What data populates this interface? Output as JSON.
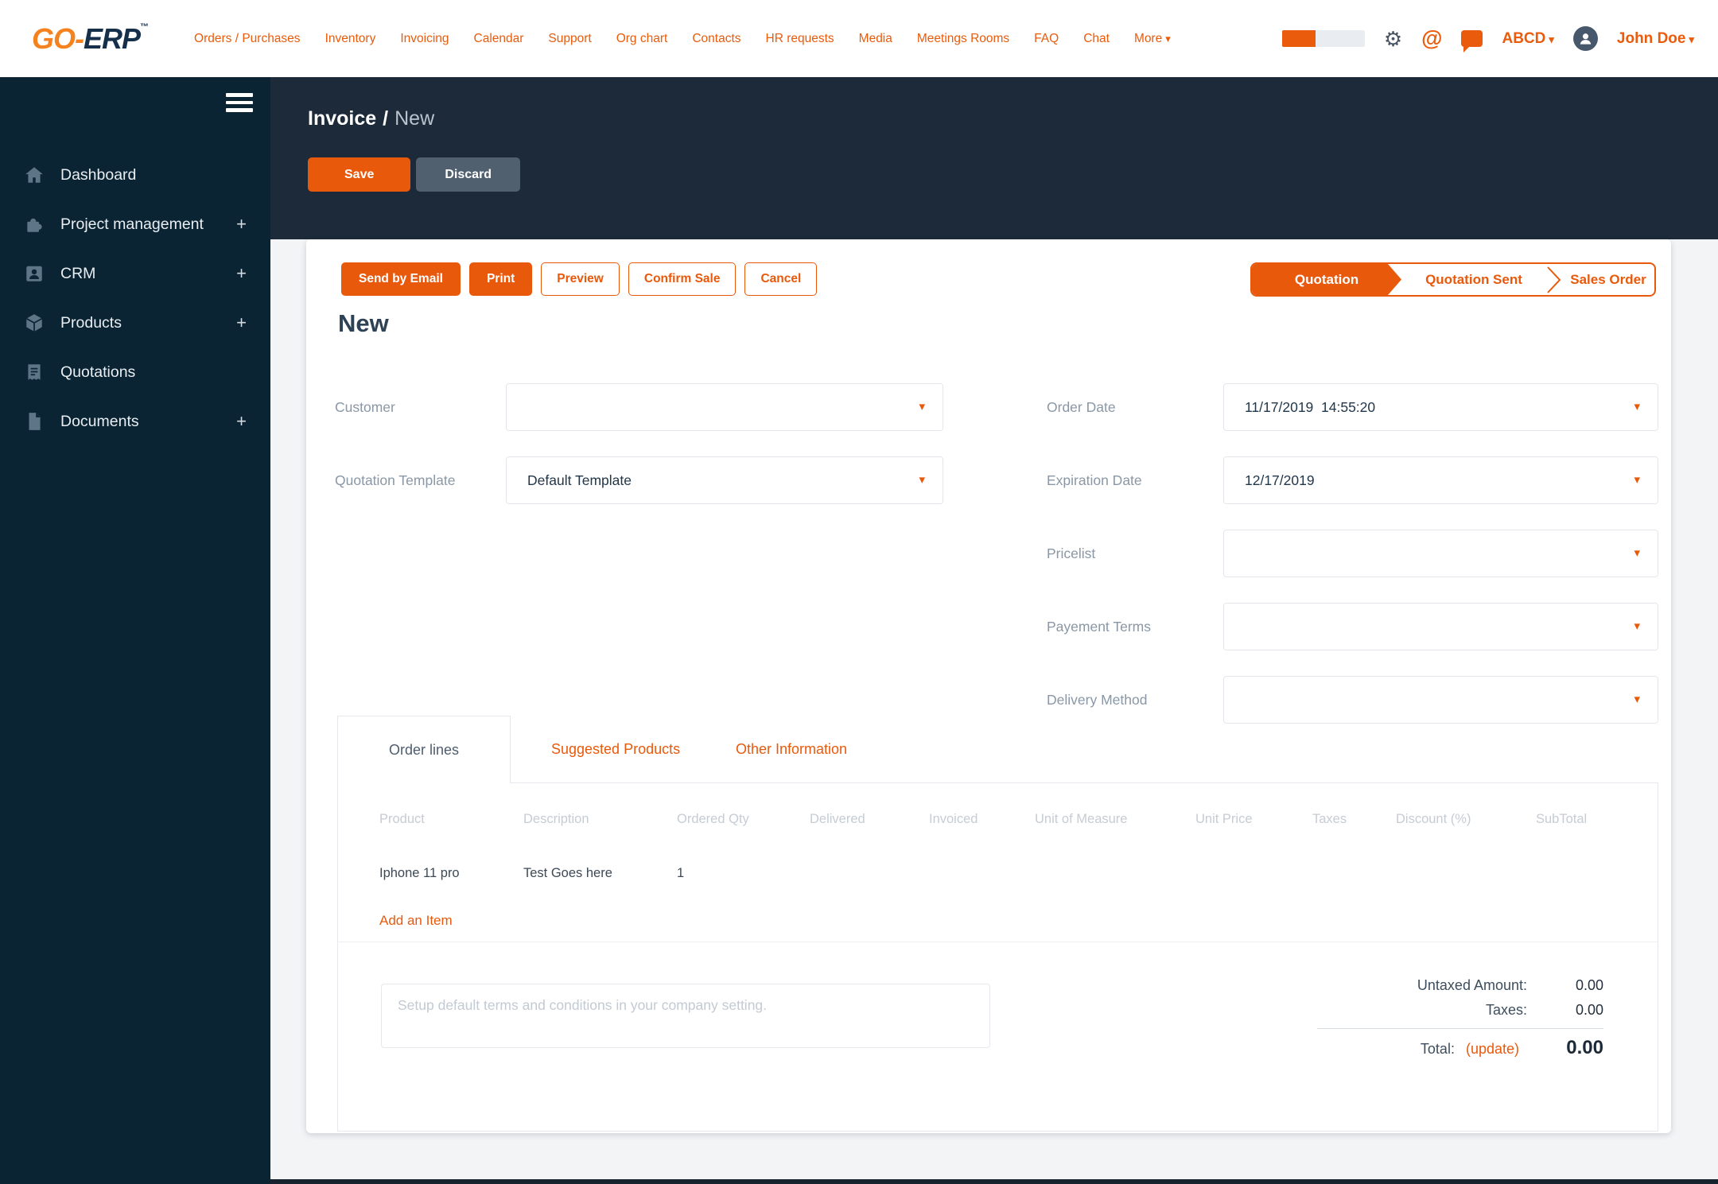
{
  "topnav": {
    "logo_part1": "GO-",
    "logo_part2": "ERP",
    "logo_tm": "™",
    "items": [
      "Orders / Purchases",
      "Inventory",
      "Invoicing",
      "Calendar",
      "Support",
      "Org chart",
      "Contacts",
      "HR requests",
      "Media",
      "Meetings Rooms",
      "FAQ",
      "Chat"
    ],
    "more_label": "More",
    "company": "ABCD",
    "user": "John Doe"
  },
  "sidebar": {
    "items": [
      {
        "label": "Dashboard",
        "plus": ""
      },
      {
        "label": "Project management",
        "plus": "+"
      },
      {
        "label": "CRM",
        "plus": "+"
      },
      {
        "label": "Products",
        "plus": "+"
      },
      {
        "label": "Quotations",
        "plus": ""
      },
      {
        "label": "Documents",
        "plus": "+"
      }
    ]
  },
  "header": {
    "breadcrumb_root": "Invoice",
    "breadcrumb_sep": "/",
    "breadcrumb_current": "New",
    "save_label": "Save",
    "discard_label": "Discard"
  },
  "actions": {
    "send_email": "Send by Email",
    "print": "Print",
    "preview": "Preview",
    "confirm_sale": "Confirm Sale",
    "cancel": "Cancel"
  },
  "pipeline": {
    "stage1": "Quotation",
    "stage2": "Quotation Sent",
    "stage3": "Sales Order"
  },
  "form": {
    "title": "New",
    "customer_label": "Customer",
    "customer_value": "",
    "quotation_template_label": "Quotation Template",
    "quotation_template_value": "Default Template",
    "order_date_label": "Order Date",
    "order_date_value": "11/17/2019  14:55:20",
    "expiration_date_label": "Expiration Date",
    "expiration_date_value": "12/17/2019",
    "pricelist_label": "Pricelist",
    "pricelist_value": "",
    "payment_terms_label": "Payement Terms",
    "payment_terms_value": "",
    "delivery_method_label": "Delivery Method",
    "delivery_method_value": ""
  },
  "tabs": {
    "order_lines": "Order lines",
    "suggested_products": "Suggested Products",
    "other_information": "Other Information"
  },
  "order_table": {
    "columns": [
      "Product",
      "Description",
      "Ordered Qty",
      "Delivered",
      "Invoiced",
      "Unit of Measure",
      "Unit Price",
      "Taxes",
      "Discount (%)",
      "SubTotal"
    ],
    "rows": [
      {
        "product": "Iphone 11 pro",
        "description": "Test Goes here",
        "ordered_qty": "1"
      }
    ],
    "add_item_label": "Add an Item"
  },
  "terms": {
    "placeholder": "Setup default terms and conditions in your company setting."
  },
  "totals": {
    "untaxed_label": "Untaxed Amount:",
    "untaxed_value": "0.00",
    "taxes_label": "Taxes:",
    "taxes_value": "0.00",
    "total_label": "Total:",
    "update_label": "(update)",
    "total_value": "0.00"
  },
  "colors": {
    "accent_orange": "#E9590C",
    "logo_orange": "#F5821F",
    "logo_navy": "#16304C",
    "sidebar_bg": "#0B2433",
    "hero_bg": "#1C2A39",
    "discard_gray": "#51606E",
    "page_bg": "#F3F4F6"
  }
}
